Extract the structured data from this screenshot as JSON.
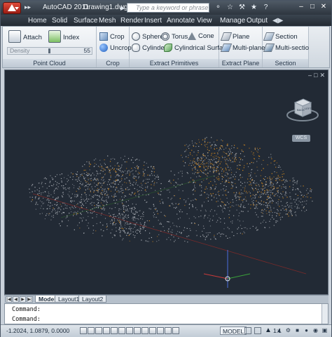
{
  "window": {
    "app_name": "AutoCAD 2011",
    "document": "Drawing1.dwg",
    "search_placeholder": "Type a keyword or phrase"
  },
  "tabs": [
    "Home",
    "Solid",
    "Surface",
    "Mesh",
    "Render",
    "Insert",
    "Annotate",
    "View",
    "Manage",
    "Output"
  ],
  "active_tab": "Point Cloud",
  "ribbon": {
    "point_cloud": {
      "title": "Point Cloud",
      "attach": "Attach",
      "index": "Index",
      "density_label": "Density",
      "density_value": "55"
    },
    "crop": {
      "title": "Crop",
      "crop": "Crop",
      "uncrop": "Uncrop"
    },
    "extract_primitives": {
      "title": "Extract Primitives",
      "sphere": "Sphere",
      "torus": "Torus",
      "cone": "Cone",
      "cylinder": "Cylinder",
      "cylindrical_surface": "Cylindrical Surface"
    },
    "extract_plane": {
      "title": "Extract Plane",
      "plane": "Plane",
      "multi_plane": "Multi-plane"
    },
    "section": {
      "title": "Section",
      "section": "Section",
      "multi_section": "Multi-section"
    }
  },
  "viewport": {
    "wcs": "WCS",
    "viewcube_labels": {
      "front": "BACK",
      "side": "LEFT"
    }
  },
  "layout_tabs": [
    "Model",
    "Layout1",
    "Layout2"
  ],
  "command_lines": [
    "Command:",
    "Command:"
  ],
  "status": {
    "coords": "-1.2024, 1.0879, 0.0000",
    "model": "MODEL",
    "scale": "1:1"
  },
  "colors": {
    "canvas": "#222a35",
    "cloud_gray": "#b8bcc2",
    "cloud_orange": "#d88a1c"
  }
}
